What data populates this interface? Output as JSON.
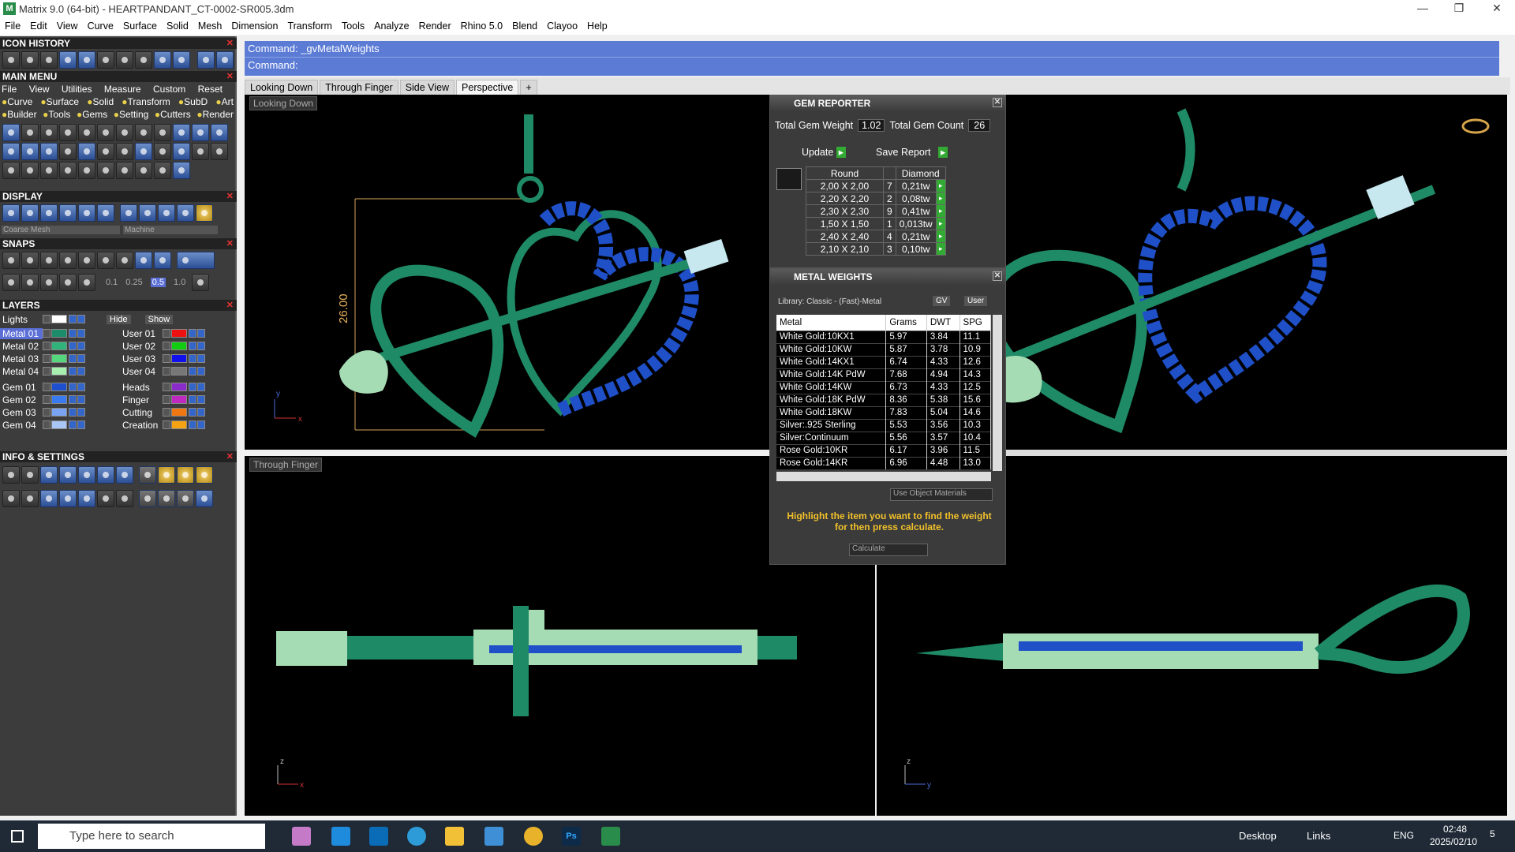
{
  "window": {
    "title": "Matrix 9.0 (64-bit) - HEARTPANDANT_CT-0002-SR005.3dm"
  },
  "menubar": [
    "File",
    "Edit",
    "View",
    "Curve",
    "Surface",
    "Solid",
    "Mesh",
    "Dimension",
    "Transform",
    "Tools",
    "Analyze",
    "Render",
    "Rhino 5.0",
    "Blend",
    "Clayoo",
    "Help"
  ],
  "left": {
    "icon_history": "ICON HISTORY",
    "main_menu": "MAIN MENU",
    "main_menu_items": [
      "File",
      "View",
      "Utilities",
      "Measure",
      "Custom",
      "Reset"
    ],
    "row1": [
      "Curve",
      "Surface",
      "Solid",
      "Transform",
      "SubD",
      "Art"
    ],
    "row2": [
      "Builder",
      "Tools",
      "Gems",
      "Setting",
      "Cutters",
      "Render"
    ],
    "display": "DISPLAY",
    "display_opts": {
      "mesh": "Coarse Mesh",
      "mat": "Machine"
    },
    "snaps": "SNAPS",
    "snap_vals": [
      "0.1",
      "0.25",
      "0.5",
      "1.0"
    ],
    "layers": "LAYERS",
    "lights": "Lights",
    "hide": "Hide",
    "show": "Show",
    "layer_left": [
      {
        "name": "Metal 01",
        "color": "#1c8c6a"
      },
      {
        "name": "Metal 02",
        "color": "#2fb37a"
      },
      {
        "name": "Metal 03",
        "color": "#55d67c"
      },
      {
        "name": "Metal 04",
        "color": "#a7f0b0"
      },
      {
        "name": "Gem 01",
        "color": "#1e4fcf"
      },
      {
        "name": "Gem 02",
        "color": "#3a7af0"
      },
      {
        "name": "Gem 03",
        "color": "#7aa4f2"
      },
      {
        "name": "Gem 04",
        "color": "#a9c6f5"
      }
    ],
    "layer_right": [
      {
        "name": "User 01",
        "color": "#ee1111"
      },
      {
        "name": "User 02",
        "color": "#11cc11"
      },
      {
        "name": "User 03",
        "color": "#1111ee"
      },
      {
        "name": "User 04",
        "color": "#777777"
      },
      {
        "name": "Heads",
        "color": "#8a2cc9"
      },
      {
        "name": "Finger",
        "color": "#c02ac0"
      },
      {
        "name": "Cutting",
        "color": "#ee7711"
      },
      {
        "name": "Creation",
        "color": "#f5a313"
      }
    ],
    "info": "INFO & SETTINGS"
  },
  "command": {
    "line1": "Command: _gvMetalWeights",
    "line2": "Command:"
  },
  "tabs": [
    "Looking Down",
    "Through Finger",
    "Side View",
    "Perspective",
    "+"
  ],
  "viewports": {
    "top_left": "Looking Down",
    "bottom_left": "Through Finger",
    "dimension": "26.00"
  },
  "gem_reporter": {
    "title": "GEM REPORTER",
    "total_weight_label": "Total Gem Weight",
    "total_weight": "1.02",
    "total_count_label": "Total Gem Count",
    "total_count": "26",
    "update": "Update",
    "save": "Save Report",
    "headers": [
      "Round",
      "",
      "Diamond"
    ],
    "rows": [
      [
        "2,00 X 2,00",
        "7",
        "0,21tw"
      ],
      [
        "2,20 X 2,20",
        "2",
        "0,08tw"
      ],
      [
        "2,30 X 2,30",
        "9",
        "0,41tw"
      ],
      [
        "1,50 X 1,50",
        "1",
        "0,013tw"
      ],
      [
        "2,40 X 2,40",
        "4",
        "0,21tw"
      ],
      [
        "2,10 X 2,10",
        "3",
        "0,10tw"
      ]
    ]
  },
  "metal_weights": {
    "title": "METAL WEIGHTS",
    "library": "Library: Classic - (Fast)-Metal",
    "gv": "GV",
    "user": "User",
    "headers": [
      "Metal",
      "Grams",
      "DWT",
      "SPG"
    ],
    "rows": [
      [
        "White Gold:10KX1",
        "5.97",
        "3.84",
        "11.1"
      ],
      [
        "White Gold:10KW",
        "5.87",
        "3.78",
        "10.9"
      ],
      [
        "White Gold:14KX1",
        "6.74",
        "4.33",
        "12.6"
      ],
      [
        "White Gold:14K PdW",
        "7.68",
        "4.94",
        "14.3"
      ],
      [
        "White Gold:14KW",
        "6.73",
        "4.33",
        "12.5"
      ],
      [
        "White Gold:18K PdW",
        "8.36",
        "5.38",
        "15.6"
      ],
      [
        "White Gold:18KW",
        "7.83",
        "5.04",
        "14.6"
      ],
      [
        "Silver:.925 Sterling",
        "5.53",
        "3.56",
        "10.3"
      ],
      [
        "Silver:Continuum",
        "5.56",
        "3.57",
        "10.4"
      ],
      [
        "Rose Gold:10KR",
        "6.17",
        "3.96",
        "11.5"
      ],
      [
        "Rose Gold:14KR",
        "6.96",
        "4.48",
        "13.0"
      ]
    ],
    "use_obj": "Use Object Materials",
    "hint": "Highlight the item you want to find the weight for then press calculate.",
    "calculate": "Calculate"
  },
  "taskbar": {
    "search": "Type here to search",
    "desktop": "Desktop",
    "links": "Links",
    "lang": "ENG",
    "time": "02:48",
    "date": "2025/02/10",
    "notif": "5"
  }
}
